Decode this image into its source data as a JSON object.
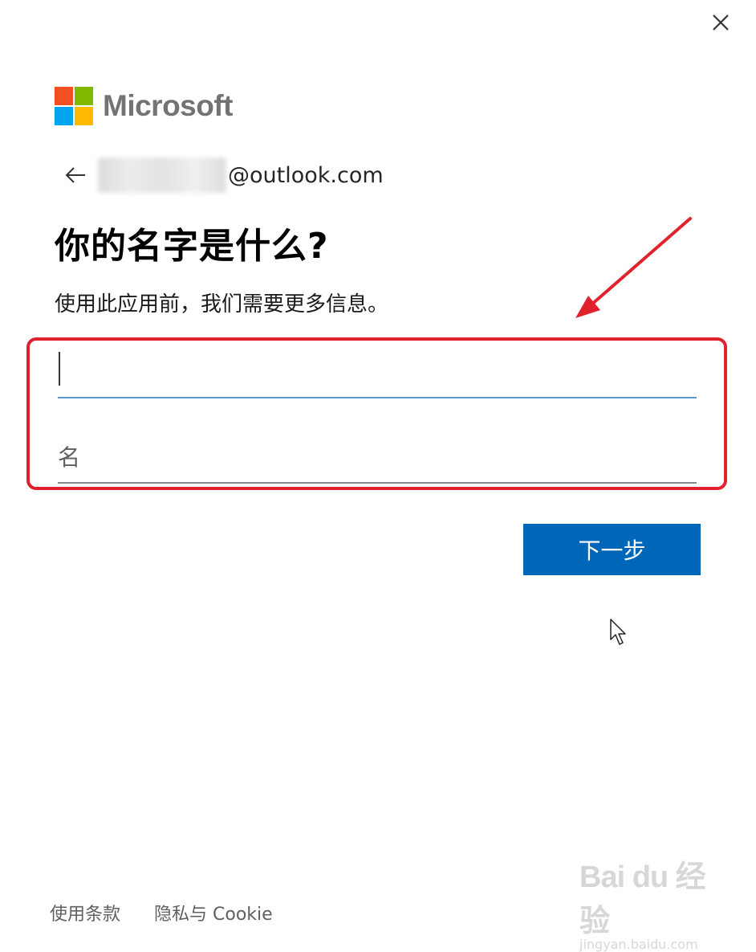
{
  "window": {
    "close_icon": "close-icon"
  },
  "brand": {
    "name": "Microsoft",
    "logo_colors": [
      "#f25022",
      "#7fba00",
      "#00a4ef",
      "#ffb900"
    ]
  },
  "identity": {
    "back_icon": "arrow-left-icon",
    "email_domain": "@outlook.com"
  },
  "page": {
    "heading": "你的名字是什么?",
    "description": "使用此应用前，我们需要更多信息。"
  },
  "form": {
    "first_name_value": "",
    "last_name_placeholder": "名"
  },
  "actions": {
    "next_label": "下一步"
  },
  "footer": {
    "terms_label": "使用条款",
    "privacy_label": "隐私与 Cookie"
  },
  "watermark": {
    "main": "Bai du 经验",
    "sub": "jingyan.baidu.com"
  },
  "colors": {
    "accent": "#0067b8",
    "annotation": "#e0222d",
    "focus_underline": "#5b9ad0"
  }
}
